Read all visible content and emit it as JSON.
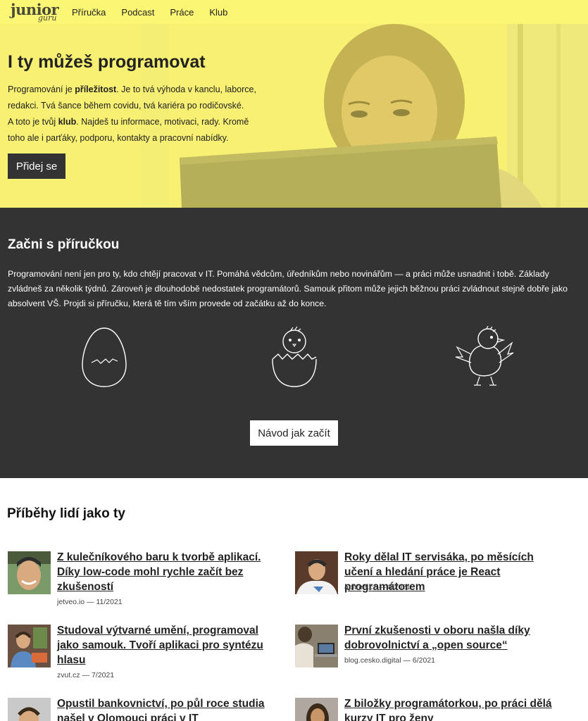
{
  "nav": {
    "logo_main": "junior",
    "logo_sub": "guru",
    "links": [
      "Příručka",
      "Podcast",
      "Práce",
      "Klub"
    ]
  },
  "hero": {
    "title": "I ty můžeš programovat",
    "p1_a": "Programování je ",
    "p1_b": "příležitost",
    "p1_c": ". Je to tvá výhoda v kanclu, laborce, redakci. Tvá šance během covidu, tvá kariéra po rodičovské.",
    "p2_a": "A toto je tvůj ",
    "p2_b": "klub",
    "p2_c": ". Najdeš tu informace, motivaci, rady. Kromě toho ale i parťáky, podporu, kontakty a pracovní nabídky.",
    "button": "Přidej se"
  },
  "guide": {
    "title": "Začni s příručkou",
    "text": "Programování není jen pro ty, kdo chtějí pracovat v IT. Pomáhá vědcům, úředníkům nebo novinářům — a práci může usnadnit i tobě. Základy zvládneš za několik týdnů. Zároveň je dlouhodobě nedostatek programátorů. Samouk přitom může jejich běžnou práci zvládnout stejně dobře jako absolvent VŠ. Projdi si příručku, která tě tím vším provede od začátku až do konce.",
    "button": "Návod jak začít"
  },
  "stories": {
    "title": "Příběhy lidí jako ty",
    "items": [
      {
        "title": "Z kulečníkového baru k tvorbě aplikací. Díky low-code mohl rychle začít bez zkušeností",
        "meta": "jetveo.io — 11/2021"
      },
      {
        "title": "Roky dělal IT servisáka, po měsících učení a hledání práce je React programátorem",
        "meta": "apitree.cz — 8/2021"
      },
      {
        "title": "Studoval výtvarné umění, programoval jako samouk. Tvoří aplikaci pro syntézu hlasu",
        "meta": "zvut.cz — 7/2021"
      },
      {
        "title": "První zkušenosti v oboru našla díky dobrovolnictví a „open source“",
        "meta": "blog.cesko.digital — 6/2021"
      },
      {
        "title": "Opustil bankovnictví, po půl roce studia našel v Olomouci práci v IT",
        "meta": ""
      },
      {
        "title": "Z biložky programátorkou, po práci dělá kurzy IT pro ženy",
        "meta": ""
      }
    ]
  },
  "colors": {
    "nav_bg": "#fbf774",
    "dark_bg": "#333333",
    "text": "#222222"
  }
}
